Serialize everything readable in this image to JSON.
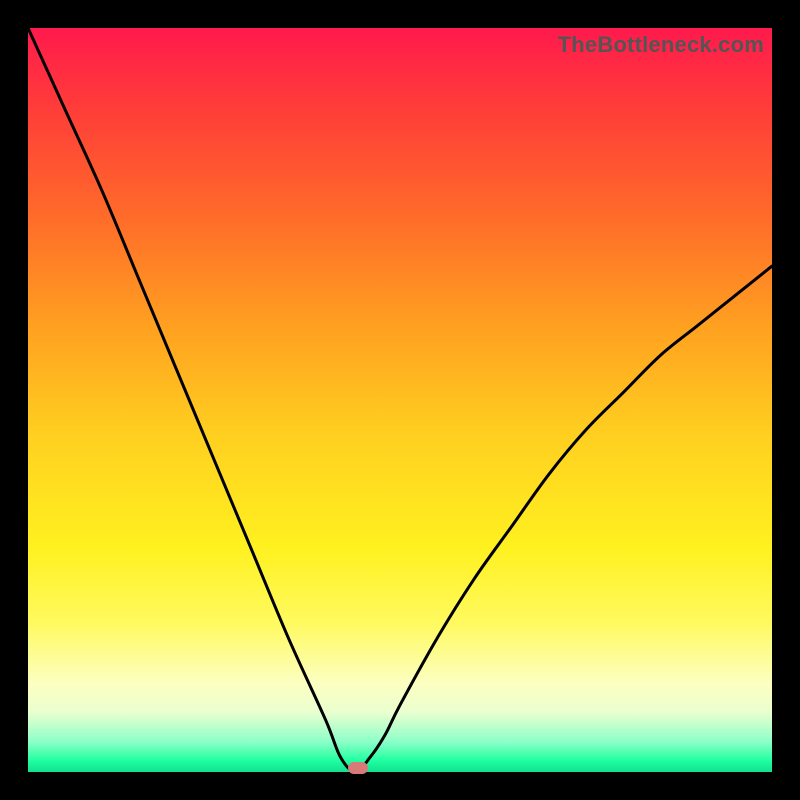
{
  "watermark": "TheBottleneck.com",
  "colors": {
    "background": "#000000",
    "curve": "#000000",
    "marker": "#d87a78"
  },
  "chart_data": {
    "type": "line",
    "title": "",
    "xlabel": "",
    "ylabel": "",
    "xlim": [
      0,
      100
    ],
    "ylim": [
      0,
      100
    ],
    "grid": false,
    "legend": false,
    "annotations": [
      {
        "text": "TheBottleneck.com",
        "position": "top-right"
      }
    ],
    "marker": {
      "x": 44.4,
      "y": 0.6
    },
    "series": [
      {
        "name": "bottleneck-curve",
        "x": [
          0,
          5,
          10,
          15,
          20,
          25,
          30,
          35,
          40,
          42,
          44,
          46,
          48,
          50,
          55,
          60,
          65,
          70,
          75,
          80,
          85,
          90,
          95,
          100
        ],
        "values": [
          100,
          89,
          78,
          66,
          54,
          42,
          30,
          18,
          7,
          2,
          0,
          2,
          5,
          9,
          18,
          26,
          33,
          40,
          46,
          51,
          56,
          60,
          64,
          68
        ]
      }
    ]
  }
}
